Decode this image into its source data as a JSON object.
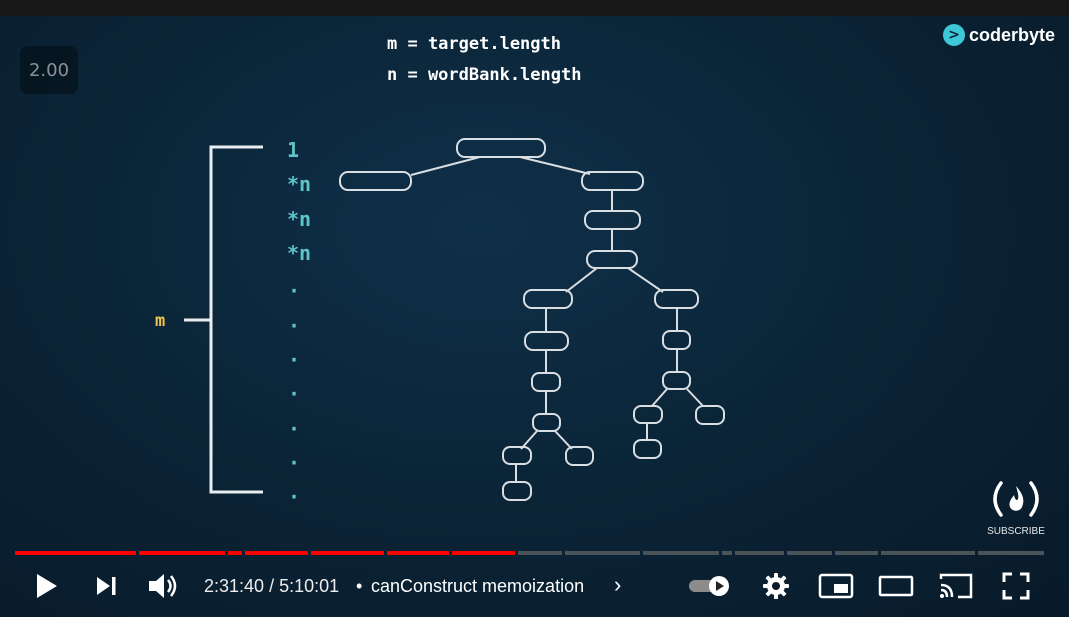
{
  "player": {
    "speed_badge": "2.00",
    "time_current": "2:31:40",
    "time_separator": " / ",
    "time_total": "5:10:01",
    "chapter_separator": "•",
    "chapter_title": "canConstruct memoization",
    "chapter_chevron": "›",
    "played_fraction": 0.485,
    "subscribe_label": "SUBSCRIBE",
    "brand_name": "coderbyte"
  },
  "slide": {
    "formula_m": "m = target.length",
    "formula_n": "n = wordBank.length",
    "height_label": "m",
    "level_labels": [
      "1",
      "*n",
      "*n",
      "*n",
      "·",
      "·",
      "·",
      "·",
      "·",
      "·",
      "·"
    ]
  },
  "icons": {
    "play": "play-icon",
    "next": "next-icon",
    "volume": "volume-icon",
    "autoplay": "autoplay-toggle-icon",
    "settings": "gear-icon",
    "miniplayer": "miniplayer-icon",
    "theater": "theater-icon",
    "cast": "cast-icon",
    "fullscreen": "fullscreen-icon"
  },
  "colors": {
    "progress_played": "#ff0000",
    "progress_unplayed": "#4a5358",
    "level_label": "#5fc4c9",
    "height_label": "#f2c14e",
    "brand": "#3ec7d6"
  }
}
